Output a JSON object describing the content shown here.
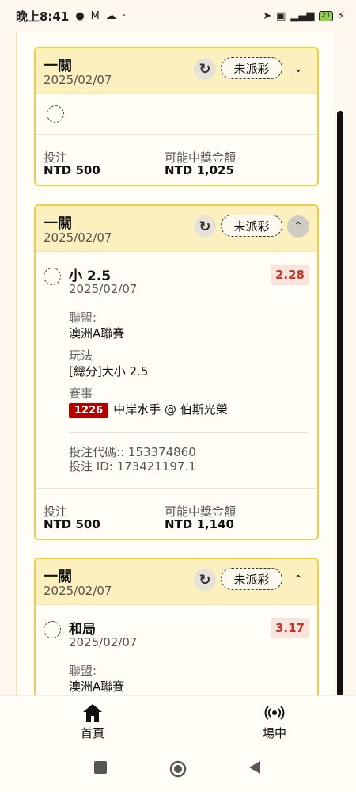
{
  "status_bar": {
    "time": "晚上8:41",
    "battery": "21"
  },
  "cards": [
    {
      "title": "一關",
      "date": "2025/02/07",
      "status": "未派彩",
      "bet_label": "投注",
      "bet_value": "NTD 500",
      "payout_label": "可能中獎金額",
      "payout_value": "NTD 1,025"
    },
    {
      "title": "一關",
      "date": "2025/02/07",
      "status": "未派彩",
      "selection": {
        "name": "小 2.5",
        "date": "2025/02/07",
        "odds": "2.28",
        "league_label": "聯盟:",
        "league_value": "澳洲A聯賽",
        "market_label": "玩法",
        "market_value": "[總分]大小 2.5",
        "event_label": "賽事",
        "event_id": "1226",
        "event_name": "中岸水手 @ 伯斯光榮",
        "bet_code": "投注代碼:: 153374860",
        "bet_id": "投注 ID: 173421197.1"
      },
      "bet_label": "投注",
      "bet_value": "NTD 500",
      "payout_label": "可能中獎金額",
      "payout_value": "NTD 1,140"
    },
    {
      "title": "一關",
      "date": "2025/02/07",
      "status": "未派彩",
      "selection": {
        "name": "和局",
        "date": "2025/02/07",
        "odds": "3.17",
        "league_label": "聯盟:",
        "league_value": "澳洲A聯賽"
      }
    }
  ],
  "bottom_nav": {
    "home": "首頁",
    "live": "場中"
  }
}
